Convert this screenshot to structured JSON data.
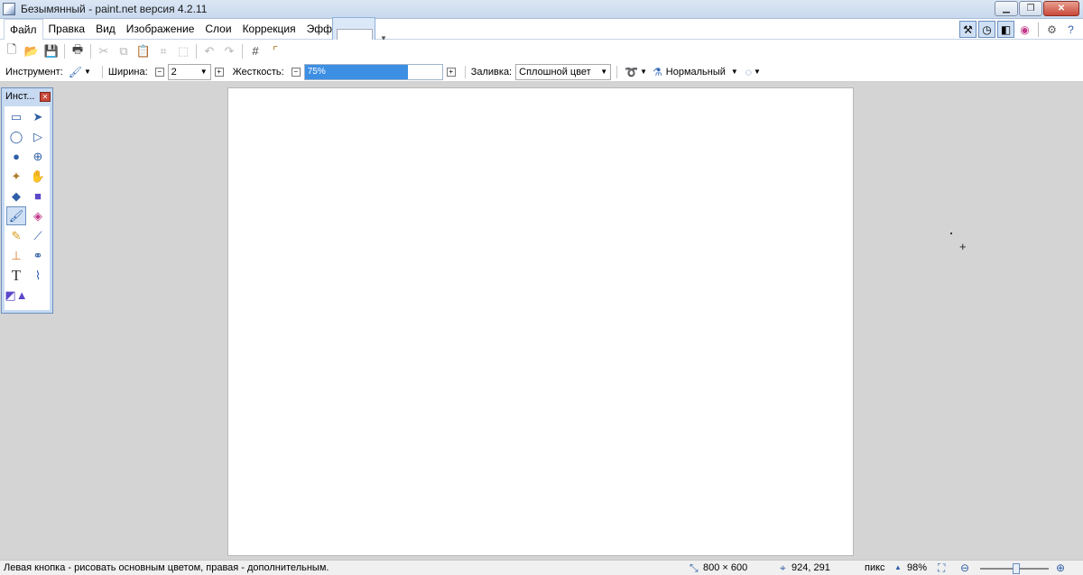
{
  "window": {
    "title": "Безымянный - paint.net версия 4.2.11"
  },
  "menu": [
    "Файл",
    "Правка",
    "Вид",
    "Изображение",
    "Слои",
    "Коррекция",
    "Эффекты"
  ],
  "toolbar2": {
    "tool_label": "Инструмент:",
    "width_label": "Ширина:",
    "width_value": "2",
    "hardness_label": "Жесткость:",
    "hardness_value": "75%",
    "hardness_fraction": 0.75,
    "fill_label": "Заливка:",
    "fill_value": "Сплошной цвет",
    "blend_value": "Нормальный"
  },
  "tools_window": {
    "title": "Инст..."
  },
  "status": {
    "hint": "Левая кнопка - рисовать основным цветом, правая - дополнительным.",
    "image_size": "800 × 600",
    "cursor_position": "924, 291",
    "units": "пикс",
    "zoom": "98%"
  },
  "colors": {
    "accent": "#3d8fe3",
    "titlebar": "#c9d9ee",
    "canvas_bg": "#d4d4d4"
  }
}
